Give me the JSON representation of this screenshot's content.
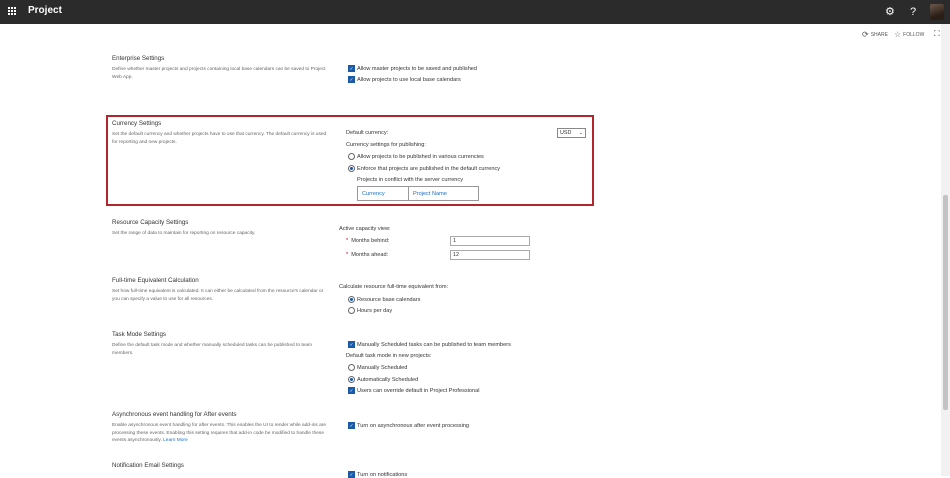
{
  "topbar": {
    "app_title": "Project",
    "icons": [
      "waffle-icon",
      "gear-icon",
      "help-icon",
      "avatar"
    ]
  },
  "actions": {
    "share": "SHARE",
    "follow": "FOLLOW"
  },
  "enterprise": {
    "title": "Enterprise Settings",
    "desc": "Define whether master projects and projects containing local base calendars can be saved to Project Web App.",
    "opt1": "Allow master projects to be saved and published",
    "opt2": "Allow projects to use local base calendars"
  },
  "currency": {
    "title": "Currency Settings",
    "desc": "Set the default currency and whether projects have to use that currency. The default currency is used for reporting and new projects.",
    "default_label": "Default currency:",
    "default_value": "USD",
    "publishing_label": "Currency settings for publishing:",
    "radio1": "Allow projects to be published in various currencies",
    "radio2": "Enforce that projects are published in the default currency",
    "conflict_label": "Projects in conflict with the server currency",
    "col_currency": "Currency",
    "col_project": "Project Name"
  },
  "capacity": {
    "title": "Resource Capacity Settings",
    "desc": "Set the range of data to maintain for reporting on resource capacity.",
    "active_label": "Active capacity view:",
    "months_behind_label": "Months behind:",
    "months_behind_value": "1",
    "months_ahead_label": "Months ahead:",
    "months_ahead_value": "12",
    "required_mark": "*"
  },
  "fte": {
    "title": "Full-time Equivalent Calculation",
    "desc": "Set how full-time equivalent is calculated. It can either be calculated from the resource's calendar or you can specify a value to use for all resources.",
    "calc_label": "Calculate resource full-time equivalent from:",
    "radio1": "Resource base calendars",
    "radio2": "Hours per day"
  },
  "taskmode": {
    "title": "Task Mode Settings",
    "desc": "Define the default task mode and whether manually scheduled tasks can be published to team members.",
    "opt_publish": "Manually Scheduled tasks can be published to team members",
    "default_label": "Default task mode in new projects:",
    "radio_manual": "Manually Scheduled",
    "radio_auto": "Automatically Scheduled",
    "opt_override": "Users can override default in Project Professional"
  },
  "async": {
    "title": "Asynchronous event handling for After events",
    "desc": "Enable asynchronous event handling for after events. This enables the UI to render while add-ins are processing these events. Enabling this setting requires that add-in code be modified to handle these events asynchronously.",
    "learn_more": "Learn More",
    "opt": "Turn on asynchronous after event processing"
  },
  "notification": {
    "title": "Notification Email Settings",
    "opt": "Turn on notifications"
  }
}
